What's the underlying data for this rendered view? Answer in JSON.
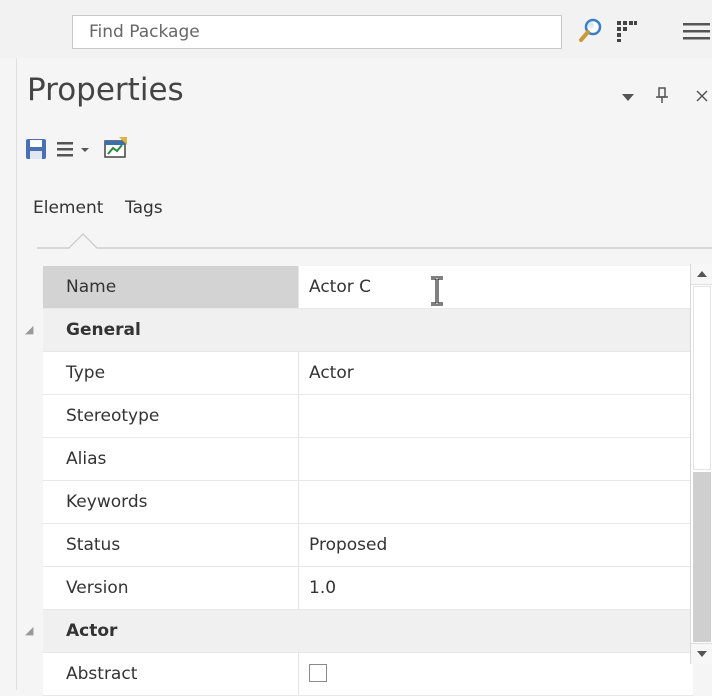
{
  "find_bar": {
    "placeholder": "Find Package",
    "icons": [
      "magnifier-icon",
      "grid-icon",
      "menu-icon"
    ]
  },
  "panel": {
    "title": "Properties",
    "header_buttons": [
      "dropdown-icon",
      "pin-icon",
      "close-icon"
    ],
    "toolbar_icons": [
      "save-icon",
      "list-menu-icon",
      "properties-icon"
    ]
  },
  "tabs": [
    {
      "label": "Element",
      "selected": true
    },
    {
      "label": "Tags",
      "selected": false
    }
  ],
  "grid": {
    "name_row": {
      "label": "Name",
      "value": "Actor C"
    },
    "sections": [
      {
        "title": "General",
        "rows": [
          {
            "label": "Type",
            "value": "Actor"
          },
          {
            "label": "Stereotype",
            "value": ""
          },
          {
            "label": "Alias",
            "value": ""
          },
          {
            "label": "Keywords",
            "value": ""
          },
          {
            "label": "Status",
            "value": "Proposed"
          },
          {
            "label": "Version",
            "value": "1.0"
          }
        ]
      },
      {
        "title": "Actor",
        "rows": [
          {
            "label": "Abstract",
            "value": "",
            "checked": false
          }
        ]
      }
    ]
  },
  "colors": {
    "background": "#f5f5f5",
    "selected_label_bg": "#d3d3d3",
    "section_bg": "#f0f0f0"
  }
}
